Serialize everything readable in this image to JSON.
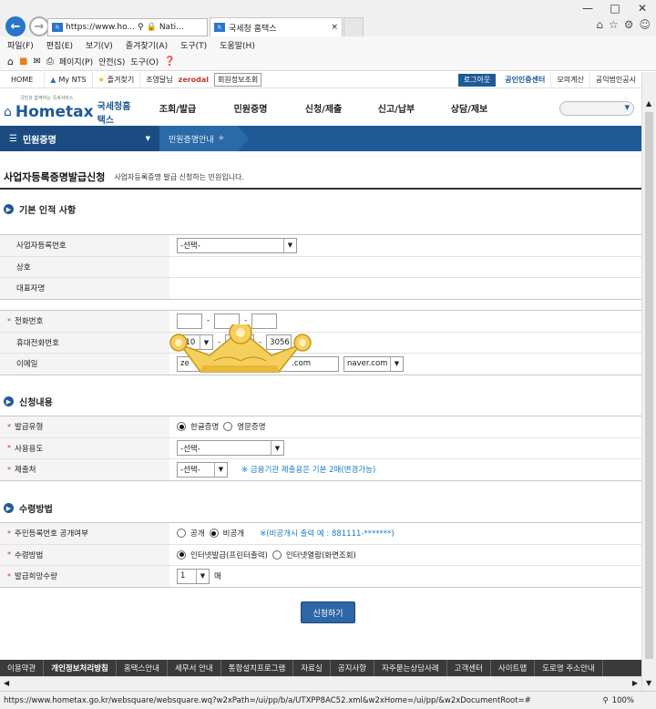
{
  "browser": {
    "address_text": "https://www.ho...",
    "address_site": "Nati...",
    "tab_title": "국세청 홈택스",
    "menu": [
      "파일(F)",
      "편집(E)",
      "보기(V)",
      "즐겨찾기(A)",
      "도구(T)",
      "도움말(H)"
    ],
    "cmd": {
      "page": "페이지(P)",
      "safety": "안전(S)",
      "tools": "도구(O)"
    },
    "status_url": "https://www.hometax.go.kr/websquare/websquare.wq?w2xPath=/ui/pp/b/a/UTXPP8AC52.xml&w2xHome=/ui/pp/&w2xDocumentRoot=#",
    "zoom": "100%"
  },
  "sitebar": {
    "home": "HOME",
    "mynts": "My NTS",
    "fav": "즐겨찾기",
    "lookup": "조영달님",
    "zerodal": "zerodal",
    "member_btn": "회원정보조회",
    "logout": "로그아웃",
    "cert": "공인인증센터",
    "simul": "모의계산",
    "corp_notice": "공익법인공시"
  },
  "logo": {
    "brand": "Hometax",
    "ko": "국세청홈택스",
    "tag": "국민과 함께하는 국세서비스"
  },
  "gnb": [
    "조회/발급",
    "민원증명",
    "신청/제출",
    "신고/납부",
    "상담/제보"
  ],
  "subnav": {
    "current": "민원증명",
    "crumb": "민원증명안내"
  },
  "page": {
    "title": "사업자등록증명발급신청",
    "desc": "사업자등록증명 발급 신청하는 민원입니다."
  },
  "sec1": {
    "title": "기본 인적 사항",
    "biz_no_label": "사업자등록번호",
    "biz_no_value": "-선택-",
    "name_label": "상호",
    "rep_label": "대표자명",
    "phone_label": "전화번호",
    "mobile_label": "휴대전화번호",
    "mobile_prefix": "010",
    "mobile_last": "3056",
    "email_label": "이메일",
    "email_local": "ze",
    "email_com": ".com",
    "email_domain": "naver.com"
  },
  "sec2": {
    "title": "신청내용",
    "type_label": "발급유형",
    "type_opt1": "한글증명",
    "type_opt2": "영문증명",
    "use_label": "사용용도",
    "use_value": "-선택-",
    "submit_to_label": "제출처",
    "submit_to_value": "-선택-",
    "submit_to_note": "※ 금융기관 제출용은 기본 2매(변경가능)"
  },
  "sec3": {
    "title": "수령방법",
    "rrn_label": "주민등록번호 공개여부",
    "rrn_opt1": "공개",
    "rrn_opt2": "비공개",
    "rrn_note": "※(비공개시 출력 예 : 881111-*******)",
    "recv_label": "수령방법",
    "recv_opt1": "인터넷발급(프린터출력)",
    "recv_opt2": "인터넷열람(화면조회)",
    "qty_label": "발급희망수량",
    "qty_value": "1",
    "qty_unit": "매"
  },
  "submit_label": "신청하기",
  "footer": [
    "이용약관",
    "개인정보처리방침",
    "홈택스안내",
    "세무서 안내",
    "통합설치프로그램",
    "자료실",
    "공지사항",
    "자주묻는상담사례",
    "고객센터",
    "사이트맵",
    "도로명 주소안내"
  ],
  "colors": {
    "nav_blue": "#1f5a96",
    "req_red": "#c0392b",
    "note_blue": "#1b7ac0"
  }
}
